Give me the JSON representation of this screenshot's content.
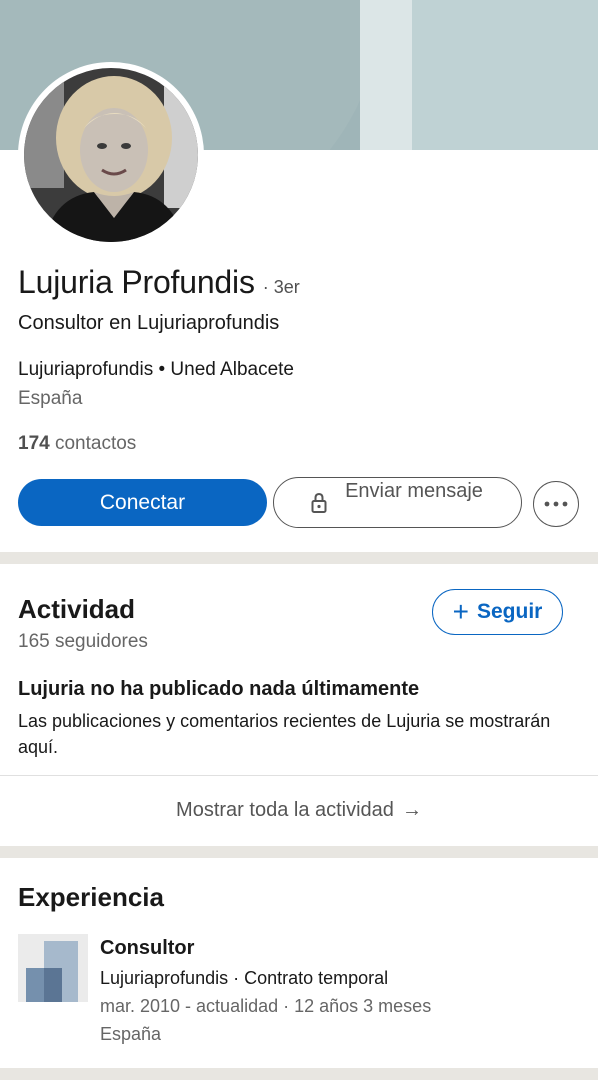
{
  "profile": {
    "name": "Lujuria Profundis",
    "degree": "· 3er",
    "headline": "Consultor en Lujuriaprofundis",
    "company_line": "Lujuriaprofundis • Uned Albacete",
    "location": "España",
    "contacts_count": "174",
    "contacts_label": "contactos"
  },
  "actions": {
    "connect_label": "Conectar",
    "message_label": "Enviar mensaje",
    "more_icon": "more-icon"
  },
  "activity": {
    "title": "Actividad",
    "followers": "165 seguidores",
    "follow_label": "Seguir",
    "empty_title": "Lujuria no ha publicado nada últimamente",
    "empty_desc": "Las publicaciones y comentarios recientes de Lujuria se mostrarán aquí.",
    "show_all": "Mostrar toda la actividad"
  },
  "experience": {
    "title": "Experiencia",
    "items": [
      {
        "role": "Consultor",
        "company": "Lujuriaprofundis · Contrato temporal",
        "dates": "mar. 2010 - actualidad · 12 años 3 meses",
        "location": "España"
      }
    ]
  },
  "colors": {
    "accent": "#0a66c2",
    "banner": "#9fb5b8"
  }
}
